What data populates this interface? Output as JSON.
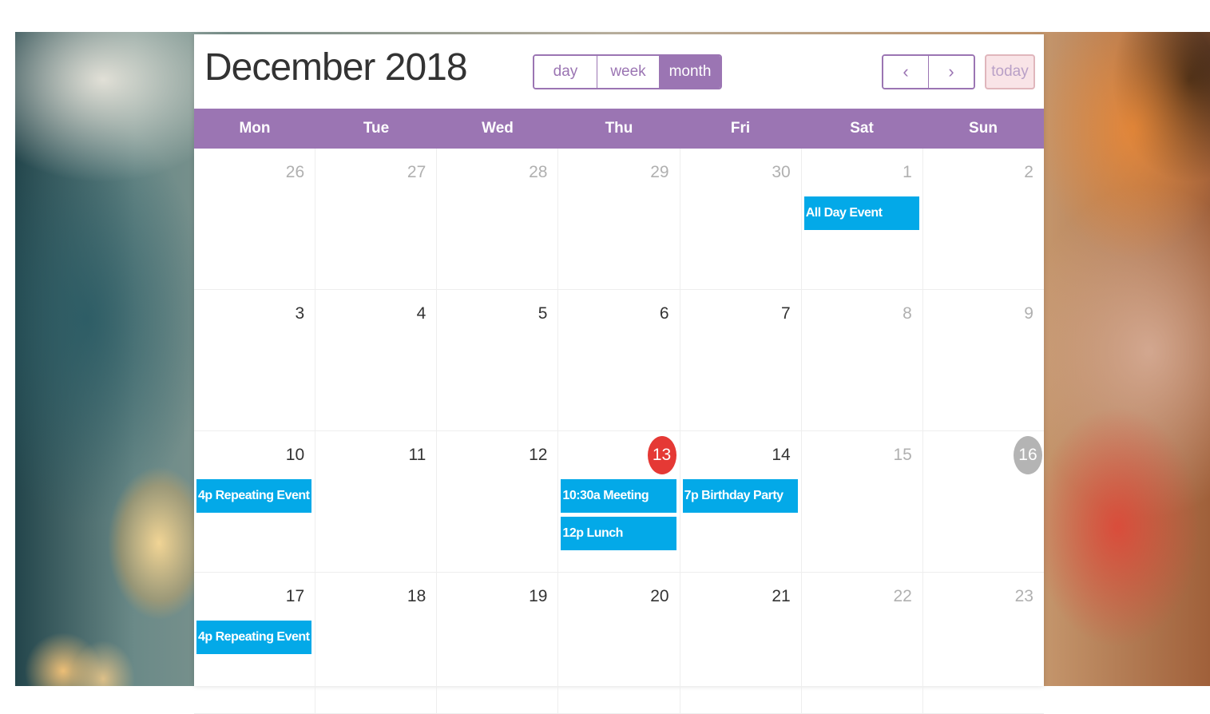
{
  "calendar": {
    "title": "December 2018",
    "views": {
      "day": "day",
      "week": "week",
      "month": "month",
      "active": "month"
    },
    "nav": {
      "prev_icon": "chevron-left-icon",
      "prev_glyph": "‹",
      "next_icon": "chevron-right-icon",
      "next_glyph": "›",
      "today_label": "today"
    },
    "weekdays": [
      "Mon",
      "Tue",
      "Wed",
      "Thu",
      "Fri",
      "Sat",
      "Sun"
    ],
    "colors": {
      "accent": "#9b75b3",
      "event": "#03a9e8",
      "today": "#e53935",
      "selected": "#b4b4b4"
    },
    "weeks": [
      {
        "days": [
          {
            "num": "26",
            "state": "other",
            "events": []
          },
          {
            "num": "27",
            "state": "other",
            "events": []
          },
          {
            "num": "28",
            "state": "other",
            "events": []
          },
          {
            "num": "29",
            "state": "other",
            "events": []
          },
          {
            "num": "30",
            "state": "other",
            "events": []
          },
          {
            "num": "1",
            "state": "weekend",
            "events": [
              "All Day Event"
            ]
          },
          {
            "num": "2",
            "state": "weekend",
            "events": []
          }
        ]
      },
      {
        "days": [
          {
            "num": "3",
            "state": "normal",
            "events": []
          },
          {
            "num": "4",
            "state": "normal",
            "events": []
          },
          {
            "num": "5",
            "state": "normal",
            "events": []
          },
          {
            "num": "6",
            "state": "normal",
            "events": []
          },
          {
            "num": "7",
            "state": "normal",
            "events": []
          },
          {
            "num": "8",
            "state": "weekend",
            "events": []
          },
          {
            "num": "9",
            "state": "weekend",
            "events": []
          }
        ]
      },
      {
        "days": [
          {
            "num": "10",
            "state": "normal",
            "events": [
              "4p Repeating Event"
            ]
          },
          {
            "num": "11",
            "state": "normal",
            "events": []
          },
          {
            "num": "12",
            "state": "normal",
            "events": []
          },
          {
            "num": "13",
            "state": "today",
            "events": [
              "10:30a Meeting",
              "12p Lunch"
            ]
          },
          {
            "num": "14",
            "state": "normal",
            "events": [
              "7p Birthday Party"
            ]
          },
          {
            "num": "15",
            "state": "weekend",
            "events": []
          },
          {
            "num": "16",
            "state": "selected",
            "events": []
          }
        ]
      },
      {
        "days": [
          {
            "num": "17",
            "state": "normal",
            "events": [
              "4p Repeating Event"
            ]
          },
          {
            "num": "18",
            "state": "normal",
            "events": []
          },
          {
            "num": "19",
            "state": "normal",
            "events": []
          },
          {
            "num": "20",
            "state": "normal",
            "events": []
          },
          {
            "num": "21",
            "state": "normal",
            "events": []
          },
          {
            "num": "22",
            "state": "weekend",
            "events": []
          },
          {
            "num": "23",
            "state": "weekend",
            "events": []
          }
        ]
      }
    ]
  }
}
